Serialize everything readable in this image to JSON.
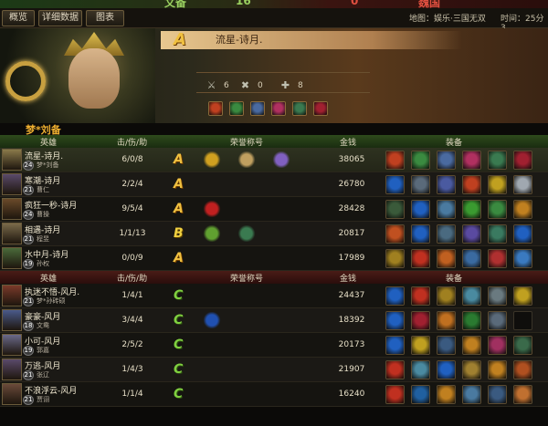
{
  "topbar": {
    "left_score": "文备",
    "left_num": "16",
    "right_num": "0",
    "right_label": "魏国"
  },
  "tabs": [
    "概览",
    "详细数据",
    "图表"
  ],
  "map_info": {
    "map": "地图：娱乐·三国无双",
    "time": "时间：25分3"
  },
  "featured": {
    "grade": "A",
    "name": "流星-诗月.",
    "stats": [
      {
        "icon": "kill-icon",
        "value": "6"
      },
      {
        "icon": "death-icon",
        "value": "0"
      },
      {
        "icon": "assist-icon",
        "value": "8"
      }
    ],
    "items": [
      "#c04020",
      "#3a8a40",
      "#4a6aa0",
      "#b03060",
      "#3a7a50",
      "#a02030"
    ],
    "badges": [
      "#d0a020",
      "#c0a060",
      "#8060c0"
    ]
  },
  "team1_label": "梦*刘备",
  "headers": {
    "hero": "英雄",
    "kda": "击/伤/助",
    "honor": "荣誉称号",
    "money": "金钱",
    "equip": "装备"
  },
  "team1": [
    {
      "name": "流星-诗月.",
      "level": "24",
      "player": "梦*刘备",
      "kda": "6/0/8",
      "grade": "A",
      "badges": [
        "#d0a020",
        "#c0a060",
        "#8060c0"
      ],
      "money": "38065",
      "items": [
        "#c04020",
        "#3a8a40",
        "#4a6aa0",
        "#b03060",
        "#3a7a50",
        "#a02030"
      ],
      "me": true,
      "ava": "#8a7a4a"
    },
    {
      "name": "寒潮-诗月",
      "level": "21",
      "player": "曹仁",
      "kda": "2/2/4",
      "grade": "A",
      "badges": [],
      "money": "26780",
      "items": [
        "#2060c0",
        "#5a6a7a",
        "#4a5aa0",
        "#c04020",
        "#c0a020",
        "#a0a8b0"
      ],
      "ava": "#5a4a6a"
    },
    {
      "name": "疯狂一秒-诗月",
      "level": "24",
      "player": "曹操",
      "kda": "9/5/4",
      "grade": "A",
      "badges": [
        "#c02020"
      ],
      "money": "28428",
      "items": [
        "#3a5a3a",
        "#2060c0",
        "#4a7aa0",
        "#3a9a30",
        "#3a8a40",
        "#c08020"
      ],
      "ava": "#6a4a2a"
    },
    {
      "name": "相遇-诗月",
      "level": "21",
      "player": "程昱",
      "kda": "1/1/13",
      "grade": "B",
      "badges": [
        "#60a030",
        "#3a7a50"
      ],
      "money": "20817",
      "items": [
        "#c05020",
        "#2060c0",
        "#4a6a80",
        "#5a4aa0",
        "#3a7a60",
        "#2060c0"
      ],
      "ava": "#7a6a4a"
    },
    {
      "name": "水中月-诗月",
      "level": "19",
      "player": "孙权",
      "kda": "0/0/9",
      "grade": "A",
      "badges": [],
      "money": "17989",
      "items": [
        "#a08020",
        "#c03020",
        "#c06020",
        "#3a6aa0",
        "#b03030",
        "#3a7ac0"
      ],
      "ava": "#4a6a3a"
    }
  ],
  "team2": [
    {
      "name": "执迷不悟-风月.",
      "level": "21",
      "player": "梦*孙砖硕",
      "kda": "1/4/1",
      "grade": "C",
      "badges": [],
      "money": "24437",
      "items": [
        "#2060c0",
        "#c03020",
        "#a08020",
        "#4a8aa0",
        "#6a7a80",
        "#c0a020"
      ],
      "ava": "#7a3a2a"
    },
    {
      "name": "豪豪-风月",
      "level": "18",
      "player": "文鸯",
      "kda": "3/4/4",
      "grade": "C",
      "badges": [
        "#2050b0"
      ],
      "money": "18392",
      "items": [
        "#2060c0",
        "#a02030",
        "#c07020",
        "#2a7a30",
        "#5a6a7a",
        "EMPTY"
      ],
      "ava": "#4a5a8a"
    },
    {
      "name": "小可-风月",
      "level": "19",
      "player": "郭嘉",
      "kda": "2/5/2",
      "grade": "C",
      "badges": [],
      "money": "20173",
      "items": [
        "#2060c0",
        "#c0a020",
        "#3a5a80",
        "#c08020",
        "#a03060",
        "#3a6a4a"
      ],
      "ava": "#6a6a8a"
    },
    {
      "name": "万逃-风月",
      "level": "21",
      "player": "张辽",
      "kda": "1/4/3",
      "grade": "C",
      "badges": [],
      "money": "21907",
      "items": [
        "#c03020",
        "#4a8aa0",
        "#2060c0",
        "#a08030",
        "#c08020",
        "#b05020"
      ],
      "ava": "#5a4a6a"
    },
    {
      "name": "不浪浮云-风月",
      "level": "21",
      "player": "贾诩",
      "kda": "1/1/4",
      "grade": "C",
      "badges": [],
      "money": "16240",
      "items": [
        "#c03020",
        "#2060a0",
        "#c08020",
        "#4a7aa0",
        "#3a5a80",
        "#c07030"
      ],
      "ava": "#6a4a3a"
    }
  ]
}
